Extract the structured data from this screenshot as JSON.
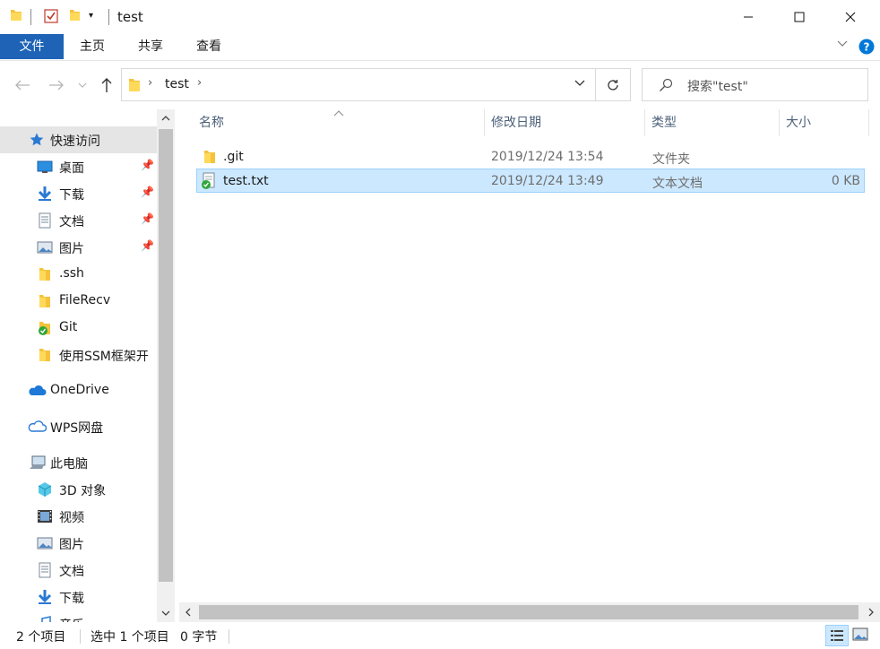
{
  "window": {
    "title": "test",
    "controls": {
      "minimize": "minimize-icon",
      "maximize": "maximize-icon",
      "close": "close-icon"
    }
  },
  "ribbon": {
    "tabs": [
      "文件",
      "主页",
      "共享",
      "查看"
    ]
  },
  "address": {
    "path": [
      "test"
    ],
    "search_placeholder": "搜索\"test\""
  },
  "sidebar": {
    "quick_access": {
      "label": "快速访问",
      "items": [
        {
          "label": "桌面",
          "icon": "desktop-icon",
          "pinned": true
        },
        {
          "label": "下载",
          "icon": "download-icon",
          "pinned": true
        },
        {
          "label": "文档",
          "icon": "document-icon",
          "pinned": true
        },
        {
          "label": "图片",
          "icon": "pictures-icon",
          "pinned": true
        },
        {
          "label": ".ssh",
          "icon": "folder-icon",
          "pinned": false
        },
        {
          "label": "FileRecv",
          "icon": "folder-icon",
          "pinned": false
        },
        {
          "label": "Git",
          "icon": "git-folder-icon",
          "pinned": false
        },
        {
          "label": "使用SSM框架开",
          "icon": "folder-icon",
          "pinned": false
        }
      ]
    },
    "onedrive": "OneDrive",
    "wps": "WPS网盘",
    "this_pc": {
      "label": "此电脑",
      "items": [
        {
          "label": "3D 对象",
          "icon": "3d-objects-icon"
        },
        {
          "label": "视频",
          "icon": "videos-icon"
        },
        {
          "label": "图片",
          "icon": "pictures-icon"
        },
        {
          "label": "文档",
          "icon": "document-icon"
        },
        {
          "label": "下载",
          "icon": "download-icon"
        },
        {
          "label": "音乐",
          "icon": "music-icon"
        }
      ]
    }
  },
  "file_list": {
    "columns": [
      "名称",
      "修改日期",
      "类型",
      "大小"
    ],
    "rows": [
      {
        "name": ".git",
        "modified": "2019/12/24 13:54",
        "type": "文件夹",
        "size": "",
        "selected": false
      },
      {
        "name": "test.txt",
        "modified": "2019/12/24 13:49",
        "type": "文本文档",
        "size": "0 KB",
        "selected": true
      }
    ]
  },
  "status": {
    "count": "2 个项目",
    "selected": "选中 1 个项目",
    "size": "0 字节"
  },
  "colors": {
    "accent": "#1e63b6",
    "selection_bg": "#cce8ff",
    "selection_border": "#99d1ff",
    "folder": "#f5c33b",
    "help": "#0078d7"
  }
}
